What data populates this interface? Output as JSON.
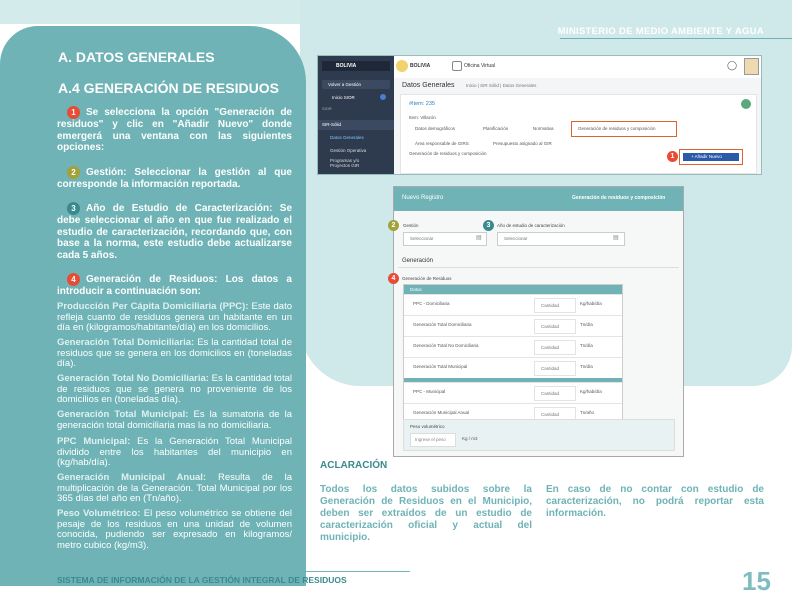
{
  "header": {
    "ministry": "MINISTERIO DE MEDIO AMBIENTE Y AGUA"
  },
  "left": {
    "title_a": "A. DATOS GENERALES",
    "title_b": "A.4 GENERACIÓN DE RESIDUOS",
    "steps": [
      {
        "num": "1",
        "text": "Se selecciona la opción \"Generación de residuos\" y clic en \"Añadir Nuevo\" donde emergerá una ventana con las siguientes opciones:"
      },
      {
        "num": "2",
        "text": "Gestión: Seleccionar la gestión al que corresponde la información reportada."
      },
      {
        "num": "3",
        "text": "Año de Estudio de Caracterización: Se debe seleccionar el año en que fue realizado el estudio de caracterización, recordando que, con base a la norma, este estudio debe actualizarse cada 5 años."
      },
      {
        "num": "4",
        "text": "Generación de Residuos: Los datos a introducir a continuación son:"
      }
    ],
    "definitions": [
      {
        "term": "Producción Per Cápita Domiciliaria (PPC):",
        "text": " Este dato refleja cuanto de residuos genera un habitante en un día en  (kilogramos/habitante/día) en los domicilios."
      },
      {
        "term": "Generación Total Domiciliaria:",
        "text": " Es la cantidad total de residuos que se genera en los domicilios en (toneladas día)."
      },
      {
        "term": "Generación Total No Domiciliaria:",
        "text": " Es la cantidad total de residuos que se genera no proveniente de los domicilios en (toneladas día)."
      },
      {
        "term": "Generación Total Municipal:",
        "text": " Es la sumatoria de la generación total domiciliaria mas la no domiciliaria."
      },
      {
        "term": "PPC Municipal:",
        "text": " Es la Generación Total Municipal dividido entre los habitantes del municipio en (kg/hab/día)."
      },
      {
        "term": "Generación Municipal Anual:",
        "text": " Resulta de la multiplicación de la Generación. Total Municipal por los 365 días del año en (Tn/año)."
      },
      {
        "term": "Peso Volumétrico:",
        "text": " El peso volumétrico se obtiene del pesaje de los residuos en una unidad de volumen conocida, pudiendo ser expresado en kilogramos/ metro cubico (kg/m3)."
      }
    ]
  },
  "screen1": {
    "brand": "BOLIVIA",
    "office": "Oficina Virtual",
    "side_items": [
      "Volver a Gestión",
      "Inicio SIOR",
      "SIOR",
      "SIR-Sólid",
      "Datos Generales",
      "Gestión Operativa",
      "Programas y/o Proyectos GIR"
    ],
    "page_title": "Datos Generales",
    "breadcrumb": "Inicio  |  SIR Sólid  |  Datos Generales",
    "item_label": "#Item: 235",
    "item_name": "Item: Villazón",
    "tabs_row1": [
      "Datos demográficos",
      "Planificación",
      "Normativa",
      "Generación de residuos y composición"
    ],
    "tabs_row2": [
      "Área responsable de GIRS",
      "Presupuesto asignado al GIR"
    ],
    "section": "Generación de residuos y composición",
    "add_button": "+ Añadir Nuevo",
    "badge": "1"
  },
  "screen2": {
    "title": "Nuevo Registro",
    "subtitle": "Generación de residuos y composición",
    "gestion_label": "Gestión",
    "year_label": "Año de estudio de caracterización",
    "select_placeholder": "Seleccionar",
    "section": "Generación",
    "gen_label": "Generación de Residuos",
    "table_header": "Datos",
    "rows": [
      {
        "label": "PPC - Domiciliaria",
        "placeholder": "Cantidad",
        "unit": "Kg/hab/día"
      },
      {
        "label": "Generación Total Domiciliaria",
        "placeholder": "Cantidad",
        "unit": "Tn/día"
      },
      {
        "label": "Generación Total No Domiciliaria",
        "placeholder": "Cantidad",
        "unit": "Tn/día"
      },
      {
        "label": "Generación Total Municipal",
        "placeholder": "Cantidad",
        "unit": "Tn/día"
      },
      {
        "label": "PPC - Municipal",
        "placeholder": "Cantidad",
        "unit": "Kg/hab/día"
      },
      {
        "label": "Generación Municipal Anual",
        "placeholder": "Cantidad",
        "unit": "Tn/año"
      }
    ],
    "peso_label": "Peso volumétrico",
    "peso_placeholder": "Ingrese el peso",
    "peso_unit": "Kg / m3",
    "badges": [
      "2",
      "3",
      "4"
    ]
  },
  "aclaracion": {
    "title": "ACLARACIÓN",
    "col1": "Todos los datos subidos sobre la Generación de Residuos en el Municipio, deben ser extraídos de un estudio de caracterización oficial y actual del municipio.",
    "col2": "En caso de no contar con estudio de caracterización, no podrá reportar esta información."
  },
  "footer": {
    "system": "SISTEMA DE  INFORMACIÓN DE LA GESTIÓN INTEGRAL DE RESIDUOS",
    "page": "15"
  }
}
